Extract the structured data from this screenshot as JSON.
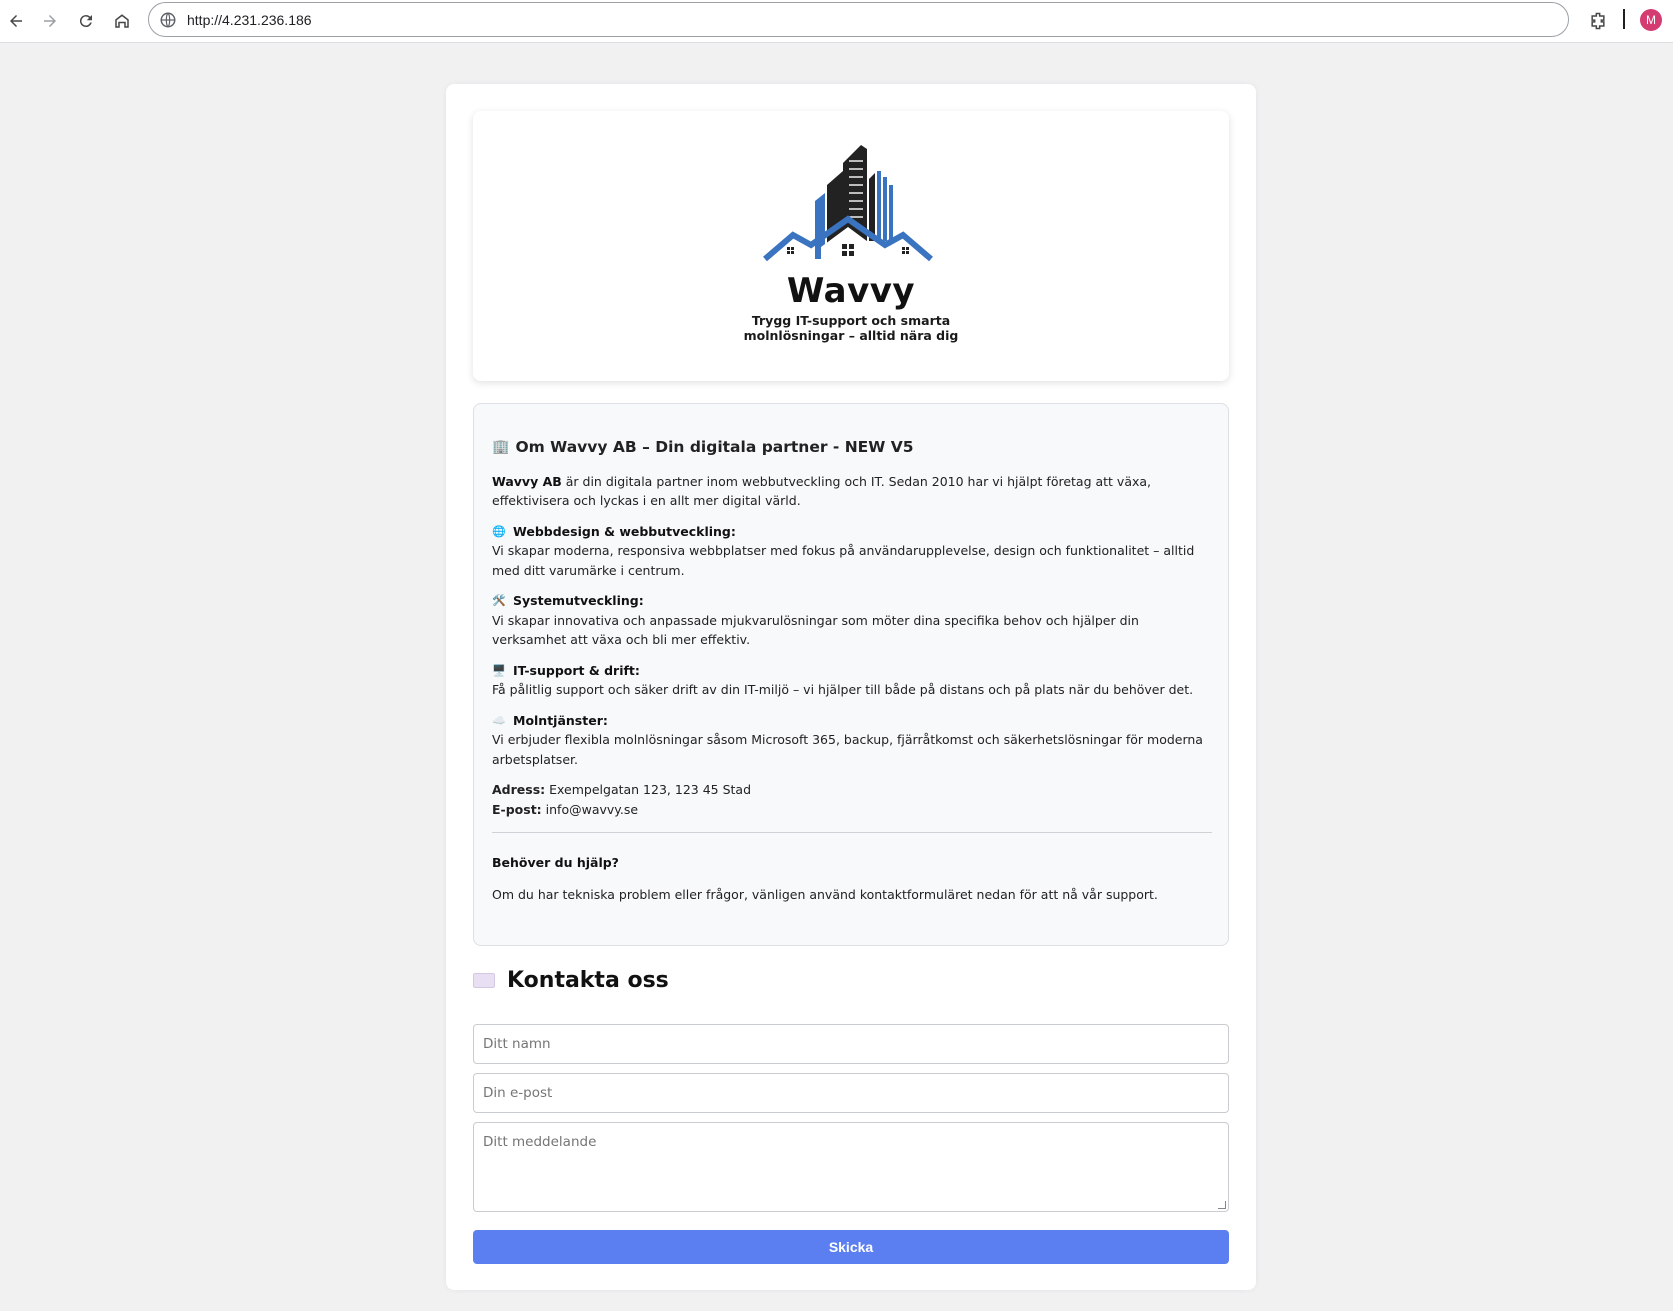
{
  "browser": {
    "url": "http://4.231.236.186",
    "avatar_letter": "M",
    "avatar_color": "#d43b71"
  },
  "logo": {
    "name": "Wavvy",
    "tagline_line1": "Trygg IT-support och smarta",
    "tagline_line2": "molnlösningar – alltid nära dig",
    "colors": {
      "dark": "#222222",
      "blue": "#3a73c0"
    }
  },
  "about": {
    "icon": "🏢",
    "title": "Om Wavvy AB – Din digitala partner - NEW V5",
    "intro_bold": "Wavvy AB",
    "intro_text": " är din digitala partner inom webbutveckling och IT. Sedan 2010 har vi hjälpt företag att växa, effektivisera och lyckas i en allt mer digital värld.",
    "services": [
      {
        "icon": "🌐",
        "icon_name": "globe-icon",
        "title": "Webbdesign & webbutveckling:",
        "text": "Vi skapar moderna, responsiva webbplatser med fokus på användarupplevelse, design och funktionalitet – alltid med ditt varumärke i centrum."
      },
      {
        "icon": "🛠️",
        "icon_name": "tools-icon",
        "title": "Systemutveckling:",
        "text": "Vi skapar innovativa och anpassade mjukvarulösningar som möter dina specifika behov och hjälper din verksamhet att växa och bli mer effektiv."
      },
      {
        "icon": "🖥️",
        "icon_name": "computer-icon",
        "title": "IT-support & drift:",
        "text": "Få pålitlig support och säker drift av din IT-miljö – vi hjälper till både på distans och på plats när du behöver det."
      },
      {
        "icon": "☁️",
        "icon_name": "cloud-icon",
        "title": "Molntjänster:",
        "text": "Vi erbjuder flexibla molnlösningar såsom Microsoft 365, backup, fjärråtkomst och säkerhetslösningar för moderna arbetsplatser."
      }
    ],
    "address_label": "Adress:",
    "address_value": " Exempelgatan 123, 123 45 Stad",
    "email_label": "E-post:",
    "email_value": " info@wavvy.se",
    "help_title": "Behöver du hjälp?",
    "help_text": "Om du har tekniska problem eller frågor, vänligen använd kontaktformuläret nedan för att nå vår support."
  },
  "contact": {
    "title": "Kontakta oss",
    "name_placeholder": "Ditt namn",
    "email_placeholder": "Din e-post",
    "message_placeholder": "Ditt meddelande",
    "submit_label": "Skicka",
    "submit_color": "#5b7ff0"
  }
}
